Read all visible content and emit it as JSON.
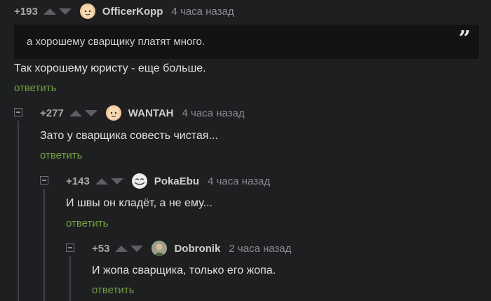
{
  "comments": [
    {
      "rating": "+193",
      "username": "OfficerKopp",
      "time": "4 часа назад",
      "quote": "а хорошему сварщику платят много.",
      "text": "Так хорошему юристу - еще больше.",
      "reply": "ответить",
      "avatar_icon": "cat-face-icon"
    },
    {
      "rating": "+277",
      "username": "WANTAH",
      "time": "4 часа назад",
      "text": "Зато у сварщика совесть чистая...",
      "reply": "ответить",
      "avatar_icon": "cat-face-icon"
    },
    {
      "rating": "+143",
      "username": "PokaEbu",
      "time": "4 часа назад",
      "text": "И швы он кладёт, а не ему...",
      "reply": "ответить",
      "avatar_icon": "troll-face-icon"
    },
    {
      "rating": "+53",
      "username": "Dobronik",
      "time": "2 часа назад",
      "text": "И жопа сварщика, только его жопа.",
      "reply": "ответить",
      "avatar_icon": "person-photo-icon"
    }
  ],
  "colors": {
    "background": "#1e1f21",
    "reply_link": "#76a341",
    "quote_background": "#121314"
  }
}
